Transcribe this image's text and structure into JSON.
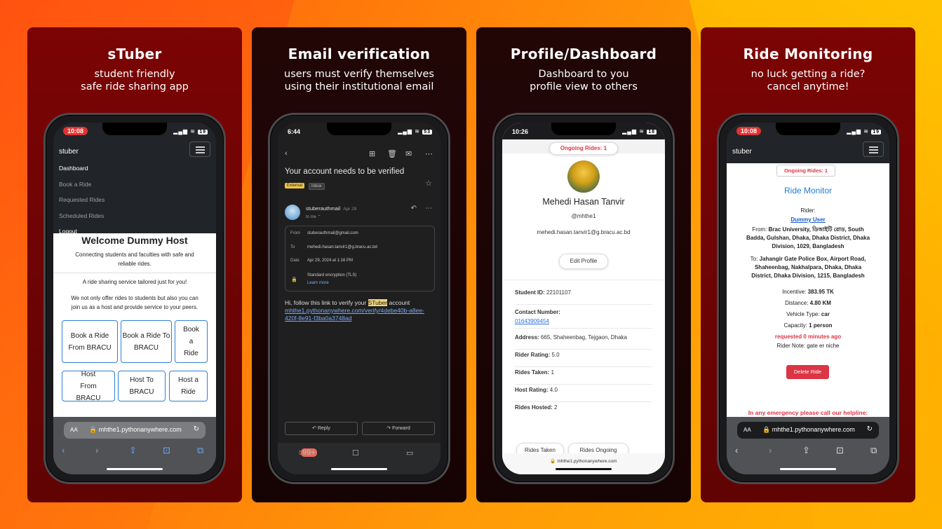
{
  "panels": [
    {
      "title": "sTuber",
      "subtitle": [
        "student friendly",
        "safe ride sharing app"
      ],
      "status_time": "10:08",
      "battery": "19",
      "navbar_brand": "stuber",
      "menu": [
        "Dashboard",
        "Book a Ride",
        "Requested Rides",
        "Scheduled Rides",
        "Logout"
      ],
      "heading": "Welcome Dummy Host",
      "tagline": [
        "Connecting students and faculties with safe and",
        "reliable rides."
      ],
      "intro": "A ride sharing service tailored just for you!",
      "paragraph": [
        "We not only offer rides to students but also you can",
        "join us as a host and provide service to your peers."
      ],
      "buttons_row1": [
        "Book a Ride From BRACU",
        "Book a Ride To BRACU",
        "Book a Ride"
      ],
      "buttons_row2": [
        "Host From BRACU",
        "Host To BRACU",
        "Host a Ride"
      ],
      "url": "mhthe1.pythonanywhere.com",
      "url_aa": "AA"
    },
    {
      "title": "Email verification",
      "subtitle": [
        "users must verify themselves",
        "using their institutional email"
      ],
      "status_time": "6:44",
      "battery": "53",
      "subject": "Your account needs to be verified",
      "tag_external": "External",
      "tag_inbox": "Inbox",
      "sender": "stuberauthmail",
      "date_short": "Apr 29",
      "to_line": "to me",
      "from_label": "From",
      "from_value": "stuberauthmail@gmail.com",
      "to_label": "To",
      "to_value": "mehedi.hasan.tanvir1@g.bracu.ac.bd",
      "date_label": "Date",
      "date_value": "Apr 29, 2024 at 1:16 PM",
      "encryption": "Standard encryption (TLS)",
      "learn_more": "Learn more",
      "body_prefix": "Hi, follow this link to verify your",
      "body_highlight": "STuber",
      "body_suffix": "account",
      "verify_link": "mhthe1.pythonanywhere.com/verify/4debe40b-a8ee-420f-8e91-f3ba0a3748ad",
      "reply_label": "Reply",
      "forward_label": "Forward",
      "mail_badge": "99+"
    },
    {
      "title": "Profile/Dashboard",
      "subtitle": [
        "Dashboard to you",
        "profile view to others"
      ],
      "status_time": "10:26",
      "battery": "18",
      "ongoing": "Ongoing Rides: 1",
      "name": "Mehedi Hasan Tanvir",
      "handle": "@mhthe1",
      "email": "mehedi.hasan.tanvir1@g.bracu.ac.bd",
      "edit_profile": "Edit Profile",
      "student_id_label": "Student ID:",
      "student_id": "22101107",
      "contact_label": "Contact Number:",
      "contact": "01643909454",
      "address_label": "Address:",
      "address": "665, Shaheenbag, Tejgaon, Dhaka",
      "rider_rating_label": "Rider Rating:",
      "rider_rating": "5.0",
      "rides_taken_label": "Rides Taken:",
      "rides_taken": "1",
      "host_rating_label": "Host Rating:",
      "host_rating": "4.0",
      "rides_hosted_label": "Rides Hosted:",
      "rides_hosted": "2",
      "tab_taken": "Rides Taken",
      "tab_ongoing": "Rides Ongoing",
      "url": "mhthe1.pythonanywhere.com"
    },
    {
      "title": "Ride Monitoring",
      "subtitle": [
        "no luck getting a ride?",
        "cancel anytime!"
      ],
      "status_time": "10:08",
      "battery": "19",
      "navbar_brand": "stuber",
      "ongoing": "Ongoing Rides: 1",
      "monitor_title": "Ride Monitor",
      "rider_label": "Rider:",
      "rider_name": "Dummy User",
      "from_label": "From:",
      "from_value": [
        "Brac University, ডিআইটি রোড, South",
        "Badda, Gulshan, Dhaka, Dhaka District, Dhaka",
        "Division, 1029, Bangladesh"
      ],
      "to_label": "To:",
      "to_value": [
        "Jahangir Gate Police Box, Airport Road,",
        "Shaheenbag, Nakhalpara, Dhaka, Dhaka",
        "District, Dhaka Division, 1215, Bangladesh"
      ],
      "incentive_label": "Incentive:",
      "incentive": "383.95 TK",
      "distance_label": "Distance:",
      "distance": "4.80 KM",
      "vehicle_label": "Vehicle Type:",
      "vehicle": "car",
      "capacity_label": "Capacity:",
      "capacity": "1 person",
      "requested": "requested 0 minutes ago",
      "note": "Rider Note: gate er niche",
      "delete_label": "Delete Ride",
      "emergency": "In any emergency please call our helpline:",
      "url": "mhthe1.pythonanywhere.com",
      "url_aa": "AA"
    }
  ],
  "colors": {
    "accent_red": "#dc3545",
    "link_blue": "#2f7fd8",
    "card_red": "#7b0404"
  }
}
